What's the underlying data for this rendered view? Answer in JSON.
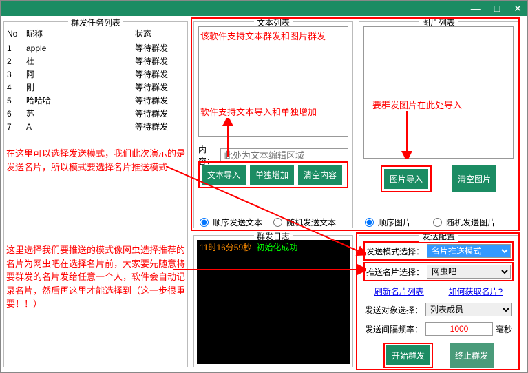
{
  "titlebar": {
    "min": "—",
    "max": "□",
    "close": "✕"
  },
  "panels": {
    "task": "群发任务列表",
    "text": "文本列表",
    "img": "图片列表",
    "log": "群发日志",
    "config": "发送配置"
  },
  "task_table": {
    "headers": {
      "no": "No",
      "nick": "昵称",
      "status": "状态"
    },
    "rows": [
      {
        "no": "1",
        "nick": "apple",
        "status": "等待群发"
      },
      {
        "no": "2",
        "nick": "杜",
        "status": "等待群发"
      },
      {
        "no": "3",
        "nick": "阿",
        "status": "等待群发"
      },
      {
        "no": "4",
        "nick": "刚",
        "status": "等待群发"
      },
      {
        "no": "5",
        "nick": "哈哈哈",
        "status": "等待群发"
      },
      {
        "no": "6",
        "nick": "苏",
        "status": "等待群发"
      },
      {
        "no": "7",
        "nick": "A",
        "status": "等待群发"
      }
    ]
  },
  "text_section": {
    "content_label": "内容：",
    "content_placeholder": "此处为文本编辑区域",
    "btn_import": "文本导入",
    "btn_add": "单独增加",
    "btn_clear": "清空内容",
    "radio_seq": "顺序发送文本",
    "radio_rand": "随机发送文本"
  },
  "img_section": {
    "btn_import": "图片导入",
    "btn_clear": "清空图片",
    "radio_seq": "顺序图片",
    "radio_rand": "随机发送图片"
  },
  "log": {
    "time": "11时16分59秒",
    "msg": "初始化成功"
  },
  "config": {
    "mode_label": "发送模式选择：",
    "mode_value": "名片推送模式",
    "card_label": "推送名片选择：",
    "card_value": "网虫吧",
    "link_refresh": "刷新名片列表",
    "link_howto": "如何获取名片?",
    "target_label": "发送对象选择：",
    "target_value": "列表成员",
    "interval_label": "发送间隔频率：",
    "interval_value": "1000",
    "interval_unit": "毫秒",
    "btn_start": "开始群发",
    "btn_stop": "终止群发"
  },
  "annotations": {
    "a1": "该软件支持文本群发和图片群发",
    "a2": "软件支持文本导入和单独增加",
    "a3": "要群发图片在此处导入",
    "a4": "在这里可以选择发送模式，我们此次演示的是发送名片，所以模式要选择名片推送模式",
    "a5": "这里选择我们要推送的模式像网虫选择推荐的名片为网虫吧在选择名片前，大家要先随意将要群发的名片发给任意一个人，软件会自动记录名片，然后再这里才能选择到（这一步很重要！！）"
  }
}
